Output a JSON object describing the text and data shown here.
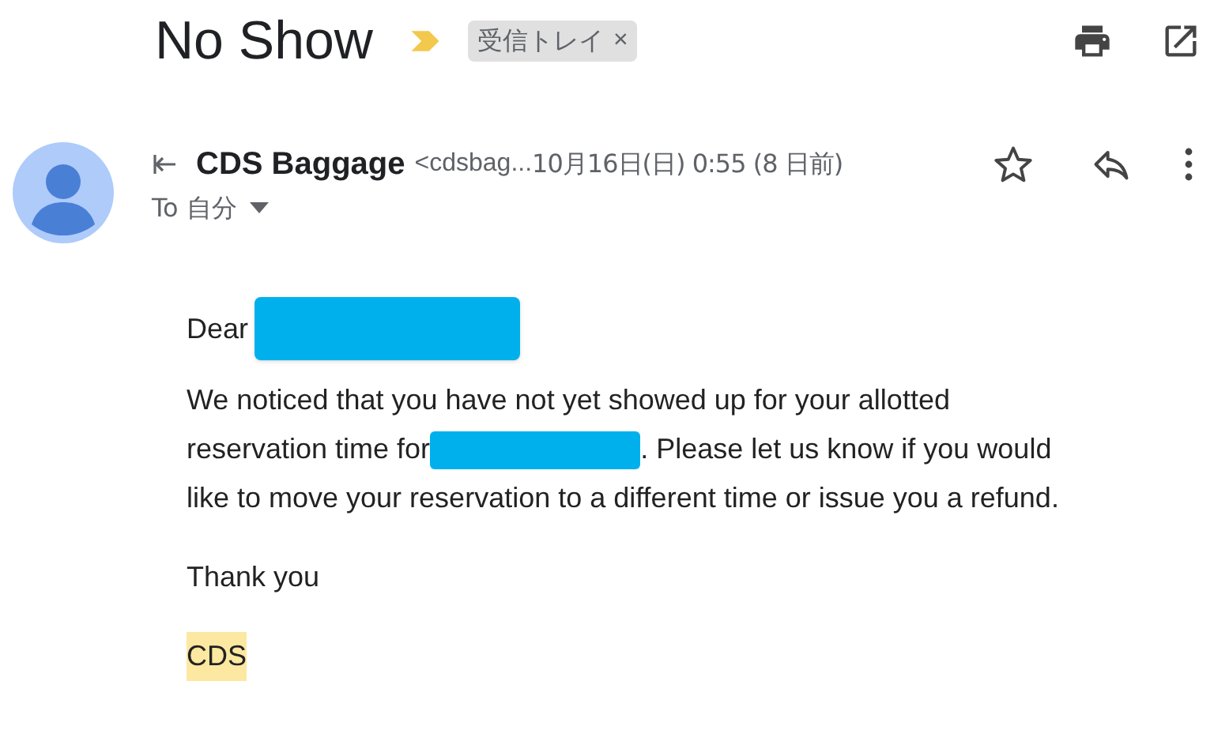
{
  "subject": "No Show",
  "important": true,
  "label": {
    "text": "受信トレイ",
    "remove": "×"
  },
  "sender": {
    "name": "CDS Baggage",
    "email": "<cdsbag...",
    "date": "10月16日(日) 0:55 (8 日前)",
    "starred": false
  },
  "recipient": {
    "text": "To 自分"
  },
  "body": {
    "greeting": "Dear",
    "paragraph": [
      "We noticed that you have not yet showed up for your allotted",
      "reservation time for",
      ". Please let us know if you would",
      "like to move your reservation to a different time or issue you a refund."
    ],
    "closing": "Thank you",
    "signature": {
      "text": "CDS",
      "highlighted": true
    }
  }
}
